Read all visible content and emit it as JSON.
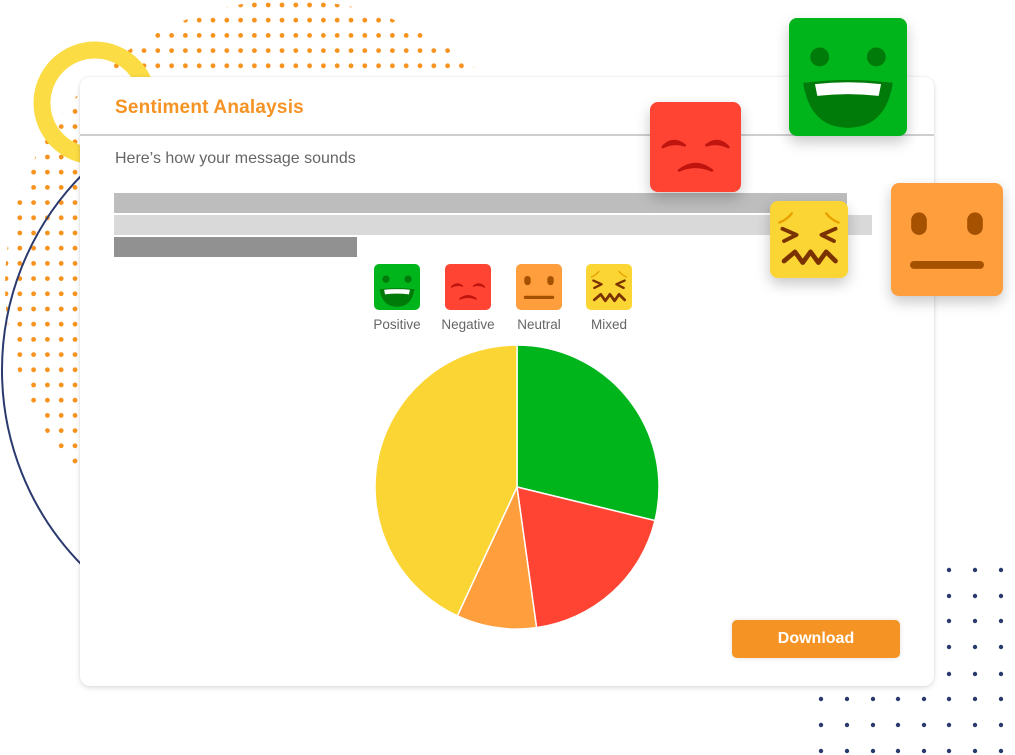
{
  "card": {
    "title": "Sentiment Analaysis",
    "subtitle": "Here’s how your message sounds",
    "download_label": "Download"
  },
  "legend": [
    {
      "label": "Positive",
      "icon": "grinning-face-icon",
      "color": "#00b51c"
    },
    {
      "label": "Negative",
      "icon": "frowning-face-icon",
      "color": "#ff4433"
    },
    {
      "label": "Neutral",
      "icon": "neutral-face-icon",
      "color": "#ff9e3d"
    },
    {
      "label": "Mixed",
      "icon": "confounded-face-icon",
      "color": "#fbd533"
    }
  ],
  "floating_faces": [
    {
      "name": "positive",
      "icon": "grinning-face-icon",
      "color": "#00b51c"
    },
    {
      "name": "negative",
      "icon": "frowning-face-icon",
      "color": "#ff4433"
    },
    {
      "name": "mixed",
      "icon": "confounded-face-icon",
      "color": "#fbd533"
    },
    {
      "name": "neutral",
      "icon": "neutral-face-icon",
      "color": "#ff9e3d"
    }
  ],
  "colors": {
    "accent": "#f59324",
    "positive": "#00b51c",
    "negative": "#ff4433",
    "neutral": "#ff9e3d",
    "mixed": "#fbd533",
    "decor_ring": "#fbdc44",
    "decor_dots_orange": "#f7931e",
    "decor_navy": "#2b3a6e"
  },
  "chart_data": {
    "type": "pie",
    "title": "",
    "start": "12 o'clock, clockwise",
    "categories": [
      "Positive",
      "Negative",
      "Neutral",
      "Mixed"
    ],
    "values": [
      28.8,
      19.0,
      9.1,
      43.1
    ],
    "unit": "percent (estimated)",
    "colors": [
      "#00b51c",
      "#ff4433",
      "#ff9e3d",
      "#fbd533"
    ],
    "legend_position": "top"
  }
}
